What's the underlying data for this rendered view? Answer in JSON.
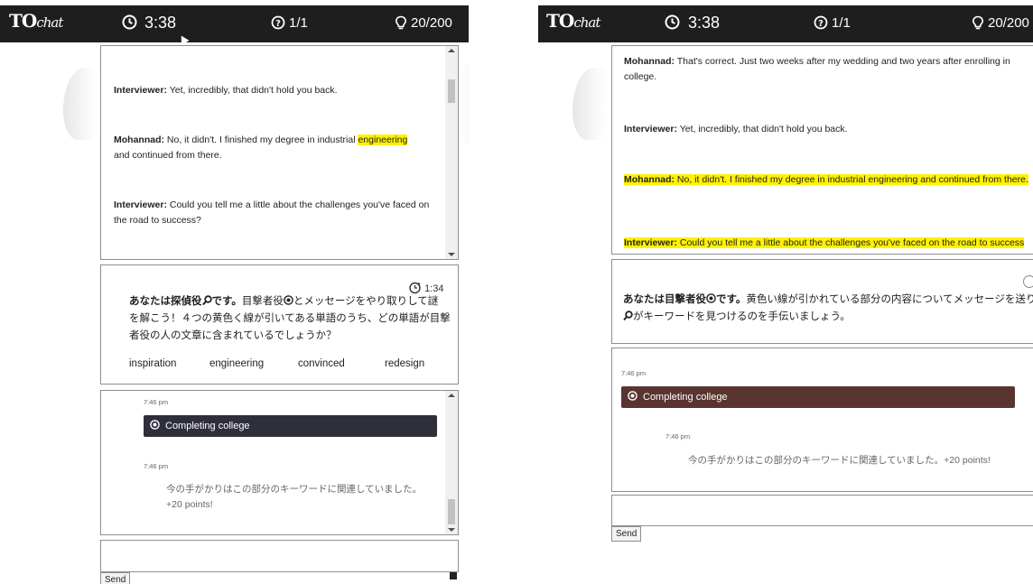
{
  "left": {
    "topbar": {
      "logo_main": "TO",
      "logo_sub": "chat",
      "clock": "3:38",
      "turns": "1/1",
      "score": "20/200"
    },
    "transcript": {
      "messages": [
        {
          "speaker": "Interviewer:",
          "text": "Yet, incredibly, that didn't hold you back."
        },
        {
          "speaker": "Mohannad:",
          "text_before": "No, it didn't. I finished my degree in industrial",
          "highlight": "engineering",
          "text_after": "and continued from there."
        },
        {
          "speaker": "Interviewer:",
          "text": "Could you tell me a little about the challenges you've faced on the road to success?"
        }
      ]
    },
    "task": {
      "timer": "1:34",
      "role_bold": "あなたは探偵役",
      "role_end": "です。",
      "line1": "目撃者役",
      "line1b": "とメッセージをやり取りして謎",
      "line2": "を解こう！４つの黄色く線が引いてある単語のうち、どの単語が目撃",
      "line3": "者役の人の文章に含まれているでしょうか？",
      "options": [
        "inspiration",
        "engineering",
        "convinced",
        "redesign"
      ]
    },
    "chat": {
      "time1": "7:46 pm",
      "clue_label": "Completing college",
      "clue_color": "#2e2f3a",
      "time2": "7:46 pm",
      "reply": "今の手がかりはこの部分のキーワードに関連していました。+20 points!"
    },
    "send_label": "Send"
  },
  "right": {
    "topbar": {
      "logo_main": "TO",
      "logo_sub": "chat",
      "clock": "3:38",
      "turns": "1/1",
      "score": "20/200"
    },
    "transcript": {
      "messages": [
        {
          "speaker": "Mohannad:",
          "text": "That's correct. Just two weeks after my wedding and two years after enrolling in college."
        },
        {
          "speaker": "Interviewer:",
          "text": "Yet, incredibly, that didn't hold you back."
        },
        {
          "speaker": "Mohannad:",
          "text": "No, it didn't. I finished my degree in industrial engineering and continued from there."
        },
        {
          "speaker": "Interviewer:",
          "text": "Could you tell me a little about the challenges you've faced on the road to success"
        }
      ]
    },
    "task": {
      "role_bold": "あなたは目撃者役",
      "role_end": "です。",
      "line1b": "黄色い線が引かれている部分の内容についてメッセージを送り、",
      "line2": "がキーワードを見つけるのを手伝いましょう。"
    },
    "chat": {
      "time1": "7:46 pm",
      "clue_label": "Completing college",
      "clue_color": "#5a3530",
      "time2": "7:46 pm",
      "reply": "今の手がかりはこの部分のキーワードに関連していました。+20 points!"
    },
    "send_label": "Send"
  }
}
